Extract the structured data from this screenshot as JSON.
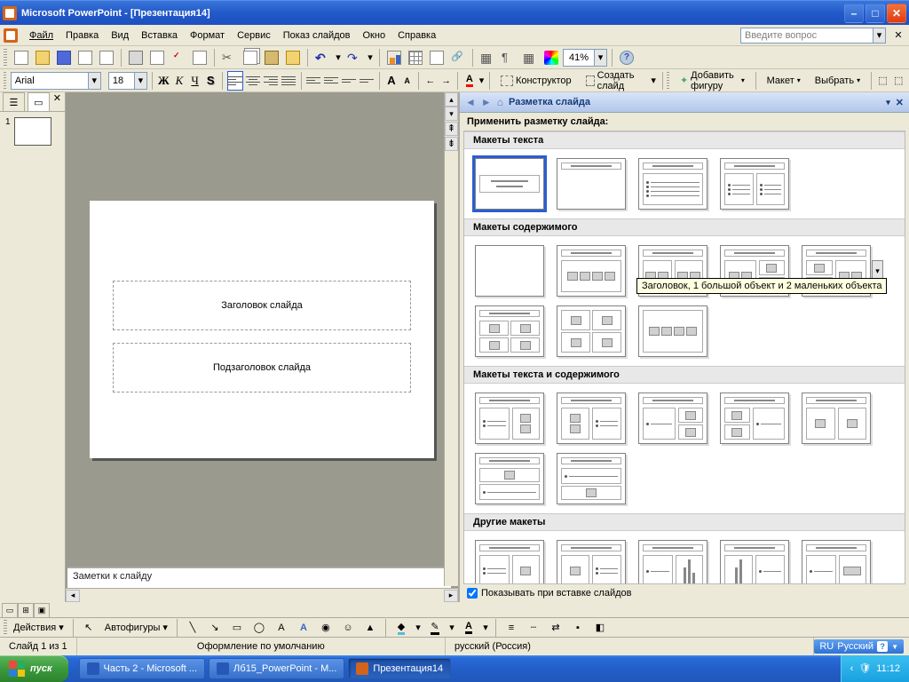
{
  "titlebar": {
    "title": "Microsoft PowerPoint - [Презентация14]"
  },
  "menu": {
    "file": "Файл",
    "edit": "Правка",
    "view": "Вид",
    "insert": "Вставка",
    "format": "Формат",
    "tools": "Сервис",
    "slideshow": "Показ слайдов",
    "window": "Окно",
    "help": "Справка"
  },
  "askbox": {
    "placeholder": "Введите вопрос"
  },
  "toolbar1": {
    "zoom": "41%"
  },
  "toolbar2": {
    "font": "Arial",
    "size": "18",
    "designer": "Конструктор",
    "newslide": "Создать слайд",
    "addshape": "Добавить фигуру",
    "layout": "Макет",
    "select": "Выбрать"
  },
  "taskpane": {
    "title": "Разметка слайда",
    "apply": "Применить разметку слайда:",
    "sections": {
      "text": "Макеты текста",
      "content": "Макеты содержимого",
      "textcontent": "Макеты текста и содержимого",
      "other": "Другие макеты"
    },
    "show_on_insert": "Показывать при вставке слайдов",
    "tooltip": "Заголовок, 1 большой объект и 2 маленьких объекта"
  },
  "slide": {
    "title": "Заголовок слайда",
    "subtitle": "Подзаголовок слайда"
  },
  "notes": "Заметки к слайду",
  "status": {
    "slide": "Слайд 1 из 1",
    "design": "Оформление по умолчанию",
    "lang": "русский (Россия)"
  },
  "langind": {
    "code": "RU",
    "name": "Русский"
  },
  "drawbar": {
    "actions": "Действия",
    "autoshapes": "Автофигуры"
  },
  "xp": {
    "start": "пуск",
    "task1": "Часть 2 - Microsoft ...",
    "task2": "Лб15_PowerPoint - M...",
    "task3": "Презентация14",
    "clock": "11:12"
  },
  "thumb": {
    "n1": "1"
  }
}
